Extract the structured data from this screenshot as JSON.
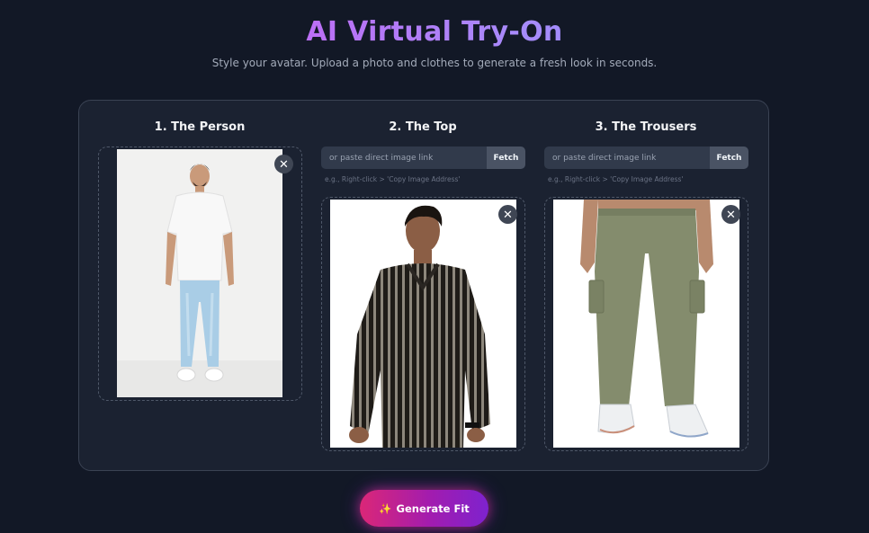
{
  "header": {
    "title": "AI Virtual Try-On",
    "subtitle": "Style your avatar. Upload a photo and clothes to generate a fresh look in seconds."
  },
  "columns": {
    "person": {
      "title": "1. The Person"
    },
    "top": {
      "title": "2. The Top",
      "url_placeholder": "or paste direct image link",
      "fetch_label": "Fetch",
      "hint": "e.g., Right-click > 'Copy Image Address'"
    },
    "trousers": {
      "title": "3. The Trousers",
      "url_placeholder": "or paste direct image link",
      "fetch_label": "Fetch",
      "hint": "e.g., Right-click > 'Copy Image Address'"
    }
  },
  "close_symbol": "✕",
  "generate": {
    "icon": "✨",
    "label": "Generate Fit"
  },
  "colors": {
    "background": "#121826",
    "card": "#1b2231",
    "accent_pink": "#db2777",
    "accent_purple": "#7e22ce",
    "title_gradient_start": "#d946ef",
    "title_gradient_end": "#818cf8"
  }
}
